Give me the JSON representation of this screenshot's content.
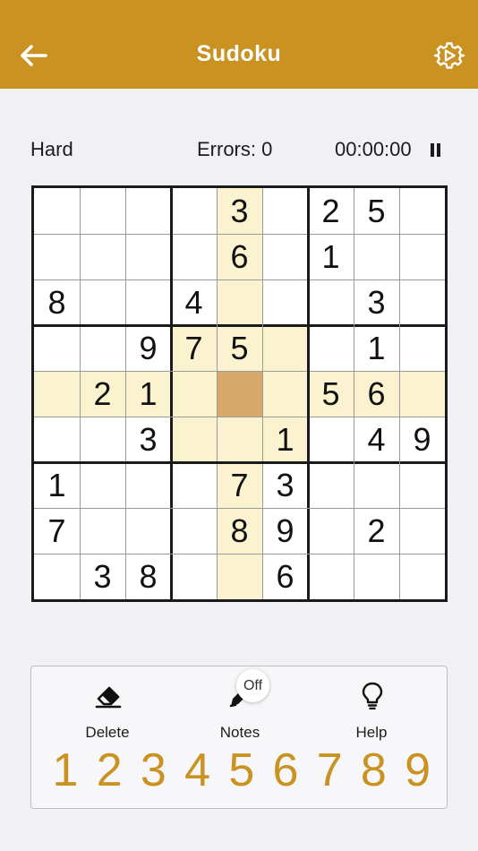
{
  "header": {
    "title": "Sudoku",
    "back_icon": "arrow-left-icon",
    "settings_icon": "gear-icon",
    "color": "#c99221"
  },
  "status": {
    "difficulty": "Hard",
    "errors": "Errors: 0",
    "timer": "00:00:00",
    "pause_icon": "pause-icon"
  },
  "board": {
    "selected": [
      4,
      4
    ],
    "highlight_color": "#fbf2cf",
    "selected_color": "#d6a96a",
    "grid": [
      [
        "",
        "",
        "",
        "",
        "3",
        "",
        "2",
        "5",
        ""
      ],
      [
        "",
        "",
        "",
        "",
        "6",
        "",
        "1",
        "",
        ""
      ],
      [
        "8",
        "",
        "",
        "4",
        "",
        "",
        "",
        "3",
        ""
      ],
      [
        "",
        "",
        "9",
        "7",
        "5",
        "",
        "",
        "1",
        ""
      ],
      [
        "",
        "2",
        "1",
        "",
        "",
        "",
        "5",
        "6",
        ""
      ],
      [
        "",
        "",
        "3",
        "",
        "",
        "1",
        "",
        "4",
        "9"
      ],
      [
        "1",
        "",
        "",
        "",
        "7",
        "3",
        "",
        "",
        ""
      ],
      [
        "7",
        "",
        "",
        "",
        "8",
        "9",
        "",
        "2",
        ""
      ],
      [
        "",
        "3",
        "8",
        "",
        "",
        "6",
        "",
        "",
        ""
      ]
    ]
  },
  "tools": {
    "delete": {
      "label": "Delete",
      "icon": "eraser-icon"
    },
    "notes": {
      "label": "Notes",
      "icon": "pencil-icon",
      "badge": "Off"
    },
    "help": {
      "label": "Help",
      "icon": "lightbulb-icon"
    }
  },
  "numpad": [
    "1",
    "2",
    "3",
    "4",
    "5",
    "6",
    "7",
    "8",
    "9"
  ]
}
